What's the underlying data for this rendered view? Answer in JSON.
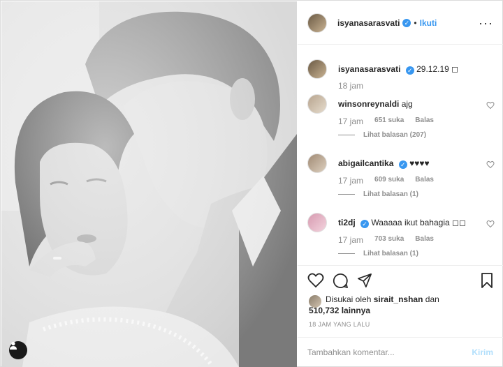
{
  "header": {
    "username": "isyanasarasvati",
    "follow_label": "Ikuti",
    "more_icon": "more-icon"
  },
  "caption": {
    "username": "isyanasarasvati",
    "text": "29.12.19 ◻",
    "time": "18 jam"
  },
  "comments": [
    {
      "username": "winsonreynaldi",
      "verified": false,
      "text": "ajg",
      "time": "17 jam",
      "likes": "651 suka",
      "reply": "Balas",
      "view_replies": "Lihat balasan (207)"
    },
    {
      "username": "abigailcantika",
      "verified": true,
      "text": "♥♥♥♥",
      "time": "17 jam",
      "likes": "609 suka",
      "reply": "Balas",
      "view_replies": "Lihat balasan (1)"
    },
    {
      "username": "ti2dj",
      "verified": true,
      "text": "Waaaaa ikut bahagia ◻◻",
      "time": "17 jam",
      "likes": "703 suka",
      "reply": "Balas",
      "view_replies": "Lihat balasan (1)"
    }
  ],
  "likes": {
    "prefix": "Disukai oleh",
    "user": "sirait_nshan",
    "and": "dan",
    "count": "510,732 lainnya"
  },
  "timestamp": "18 JAM YANG LALU",
  "composer": {
    "placeholder": "Tambahkan komentar...",
    "send_label": "Kirim"
  },
  "colors": {
    "accent": "#3897f0",
    "muted": "#8e8e8e",
    "text": "#262626",
    "send_disabled": "#b2dffc"
  }
}
